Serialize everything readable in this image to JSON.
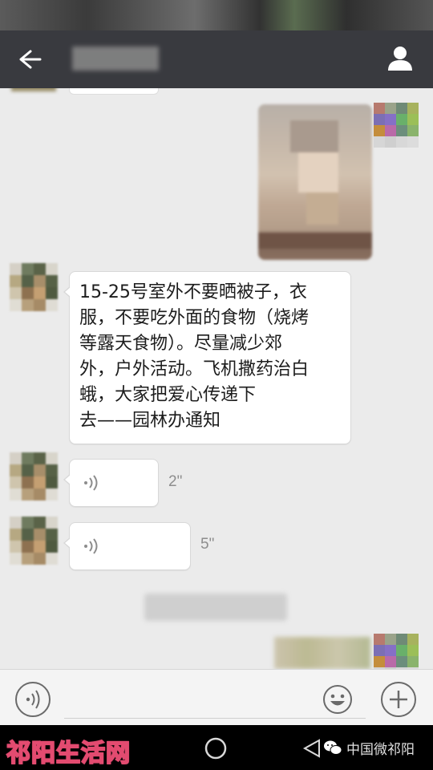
{
  "chat": {
    "messages": [
      {
        "type": "text",
        "text": "15-25号室外不要晒被子，衣\n服，不要吃外面的食物（烧烤\n等露天食物）。尽量减少郊\n外，户外活动。飞机撒药治白\n蛾，大家把爱心传递下\n去——园林办通知"
      },
      {
        "type": "voice",
        "duration": "2\""
      },
      {
        "type": "voice",
        "duration": "5\""
      }
    ]
  },
  "watermark": {
    "left": "祁阳生活网",
    "right": "中国微祁阳"
  },
  "icons": {
    "back": "arrow-left-icon",
    "profile": "person-icon",
    "voice_message": "sound-wave-icon",
    "voice_mode": "voice-mode-icon",
    "emoji": "smiley-icon",
    "more": "plus-icon"
  },
  "colors": {
    "appbar": "#393a3f",
    "chat_bg": "#ebebeb",
    "bubble": "#ffffff",
    "navbar": "#000000"
  }
}
